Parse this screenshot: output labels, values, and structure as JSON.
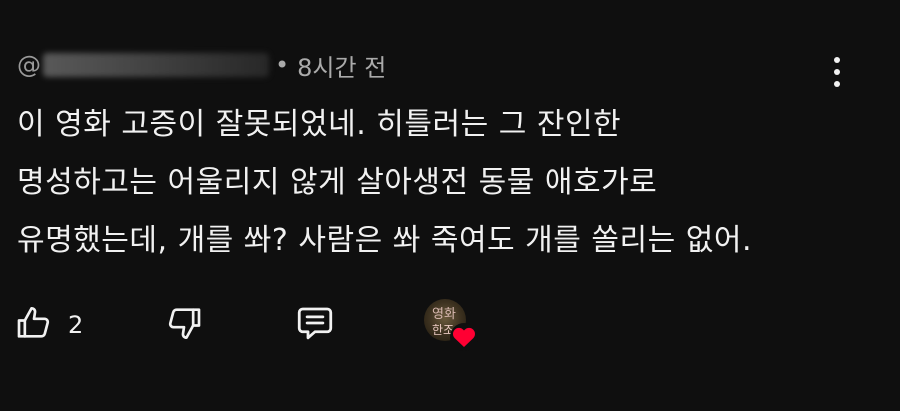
{
  "comment": {
    "author_prefix": "@",
    "separator": "•",
    "time": "8시간 전",
    "lines": [
      "이 영화 고증이 잘못되었네. 히틀러는 그 잔인한",
      "명성하고는 어울리지 않게 살아생전 동물 애호가로",
      "유명했는데, 개를 쏴? 사람은 쏴 죽여도 개를 쏠리는 없어."
    ],
    "like_count": "2",
    "creator_avatar_text": [
      "영화",
      "한조"
    ]
  },
  "icons": {
    "like": "thumbs-up-icon",
    "dislike": "thumbs-down-icon",
    "reply": "reply-comment-icon",
    "more": "more-vertical-icon",
    "heart": "heart-icon"
  },
  "colors": {
    "background": "#0f0f0f",
    "text": "#f1f1f1",
    "meta": "#aaaaaa",
    "heart": "#ff0033"
  }
}
